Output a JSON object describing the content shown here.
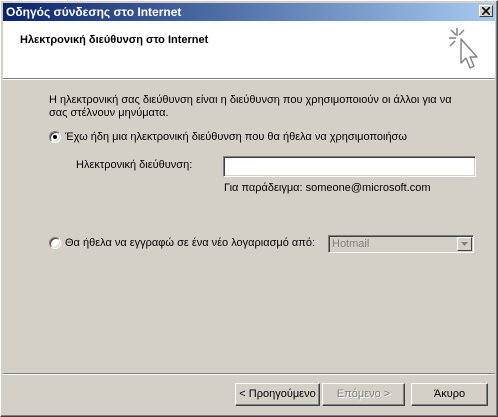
{
  "window": {
    "title": "Οδηγός σύνδεσης στο Internet",
    "close_glyph": "×"
  },
  "header": {
    "title": "Ηλεκτρονική διεύθυνση στο Internet",
    "icon": "wizard-sparkle-cursor-icon"
  },
  "body": {
    "description": "Η ηλεκτρονική σας διεύθυνση είναι η διεύθυνση που χρησιμοποιούν οι άλλοι για να σας στέλνουν μηνύματα.",
    "option_existing": {
      "label": "Έχω ήδη μια ηλεκτρονική διεύθυνση που θα ήθελα να χρησιμοποιήσω",
      "selected": true
    },
    "email_field": {
      "label": "Ηλεκτρονική διεύθυνση:",
      "value": ""
    },
    "example": "Για παράδειγμα: someone@microsoft.com",
    "option_new": {
      "label": "Θα ήθελα να εγγραφώ σε ένα νέο λογαριασμό από:",
      "selected": false
    },
    "provider_select": {
      "value": "Hotmail",
      "enabled": false
    }
  },
  "buttons": {
    "back": "< Προηγούμενο",
    "next": "Επόμενο >",
    "cancel": "Άκυρο"
  },
  "colors": {
    "titlebar_start": "#0a246a",
    "titlebar_end": "#a6caf0",
    "face": "#d4d0c8"
  }
}
